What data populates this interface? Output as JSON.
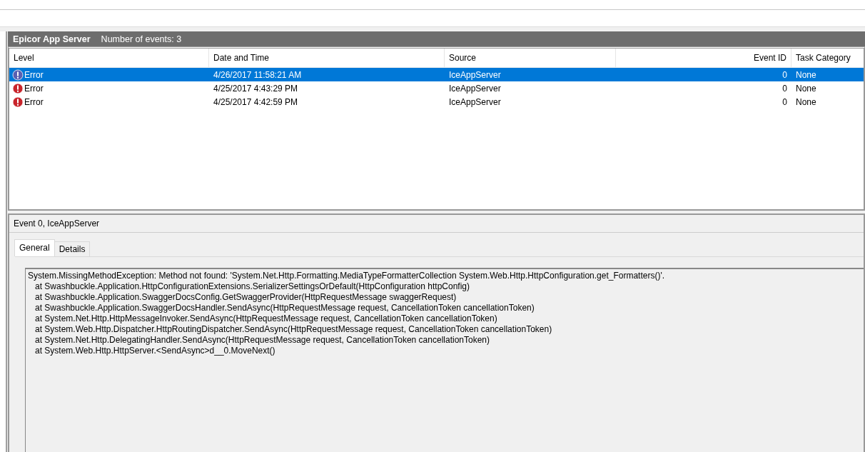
{
  "header": {
    "title": "Epicor App Server",
    "count": "Number of events: 3"
  },
  "table": {
    "columns": [
      {
        "label": "Level",
        "kind": "text"
      },
      {
        "label": "Date and Time",
        "kind": "text"
      },
      {
        "label": "Source",
        "kind": "text"
      },
      {
        "label": "Event ID",
        "kind": "number"
      },
      {
        "label": "Task Category",
        "kind": "text"
      }
    ],
    "rows": [
      {
        "selected": true,
        "cells": [
          "Error",
          "4/26/2017 11:58:21 AM",
          "IceAppServer",
          "0",
          "None"
        ]
      },
      {
        "selected": false,
        "cells": [
          "Error",
          "4/25/2017 4:43:29 PM",
          "IceAppServer",
          "0",
          "None"
        ]
      },
      {
        "selected": false,
        "cells": [
          "Error",
          "4/25/2017 4:42:59 PM",
          "IceAppServer",
          "0",
          "None"
        ]
      }
    ]
  },
  "details": {
    "title": "Event 0, IceAppServer",
    "tabs": [
      {
        "label": "General",
        "selected": true
      },
      {
        "label": "Details",
        "selected": false
      }
    ],
    "lines": [
      "System.MissingMethodException: Method not found: 'System.Net.Http.Formatting.MediaTypeFormatterCollection System.Web.Http.HttpConfiguration.get_Formatters()'.",
      "   at Swashbuckle.Application.HttpConfigurationExtensions.SerializerSettingsOrDefault(HttpConfiguration httpConfig)",
      "   at Swashbuckle.Application.SwaggerDocsConfig.GetSwaggerProvider(HttpRequestMessage swaggerRequest)",
      "   at Swashbuckle.Application.SwaggerDocsHandler.SendAsync(HttpRequestMessage request, CancellationToken cancellationToken)",
      "   at System.Net.Http.HttpMessageInvoker.SendAsync(HttpRequestMessage request, CancellationToken cancellationToken)",
      "   at System.Web.Http.Dispatcher.HttpRoutingDispatcher.SendAsync(HttpRequestMessage request, CancellationToken cancellationToken)",
      "   at System.Net.Http.DelegatingHandler.SendAsync(HttpRequestMessage request, CancellationToken cancellationToken)",
      "   at System.Web.Http.HttpServer.<SendAsync>d__0.MoveNext()"
    ]
  }
}
